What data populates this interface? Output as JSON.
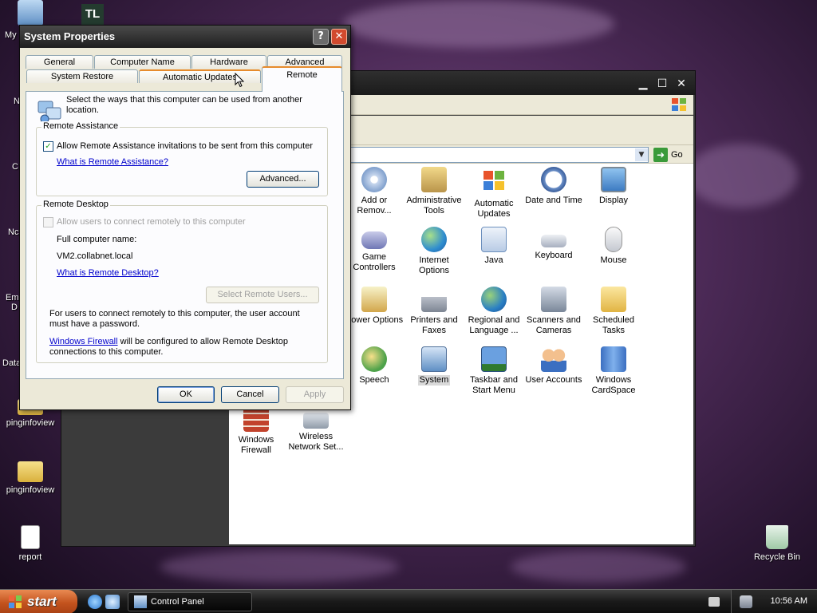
{
  "desktop": {
    "icons": [
      {
        "label": "pinginfoview"
      },
      {
        "label": "pinginfoview"
      },
      {
        "label": "report"
      },
      {
        "label": "Recycle Bin"
      }
    ],
    "partial_labels": [
      "My",
      "N",
      "C",
      "Nc",
      "Em",
      "D",
      "Data"
    ],
    "top_icon_text": "TL"
  },
  "control_panel": {
    "go_label": "Go",
    "items": [
      {
        "label": "Add or Remov..."
      },
      {
        "label": "Administrative Tools"
      },
      {
        "label": "Automatic Updates"
      },
      {
        "label": "Date and Time"
      },
      {
        "label": "Display"
      },
      {
        "label": "Game Controllers"
      },
      {
        "label": "Internet Options"
      },
      {
        "label": "Java"
      },
      {
        "label": "Keyboard"
      },
      {
        "label": "Mouse"
      },
      {
        "label": "Power Options"
      },
      {
        "label": "Printers and Faxes"
      },
      {
        "label": "Regional and Language ..."
      },
      {
        "label": "Scanners and Cameras"
      },
      {
        "label": "Scheduled Tasks"
      },
      {
        "label": "Speech"
      },
      {
        "label": "System"
      },
      {
        "label": "Taskbar and Start Menu"
      },
      {
        "label": "User Accounts"
      },
      {
        "label": "Windows CardSpace"
      },
      {
        "label": "Windows Firewall"
      },
      {
        "label": "Wireless Network Set..."
      }
    ]
  },
  "dialog": {
    "title": "System Properties",
    "help_label": "?",
    "close_label": "✕",
    "tabs": {
      "general": "General",
      "computer_name": "Computer Name",
      "hardware": "Hardware",
      "advanced": "Advanced",
      "system_restore": "System Restore",
      "automatic_updates": "Automatic Updates",
      "remote": "Remote"
    },
    "intro": "Select the ways that this computer can be used from another location.",
    "remote_assistance": {
      "group_label": "Remote Assistance",
      "checkbox_label": "Allow Remote Assistance invitations to be sent from this computer",
      "checked": true,
      "link": "What is Remote Assistance?",
      "advanced_button": "Advanced..."
    },
    "remote_desktop": {
      "group_label": "Remote Desktop",
      "checkbox_label": "Allow users to connect remotely to this computer",
      "checked": false,
      "full_name_label": "Full computer name:",
      "full_name_value": "VM2.collabnet.local",
      "link": "What is Remote Desktop?",
      "select_users_button": "Select Remote Users...",
      "password_note": "For users to connect remotely to this computer, the user account must have a password.",
      "firewall_link": "Windows Firewall",
      "firewall_note": " will be configured to allow Remote Desktop connections to this computer."
    },
    "buttons": {
      "ok": "OK",
      "cancel": "Cancel",
      "apply": "Apply"
    }
  },
  "taskbar": {
    "start_label": "start",
    "task_label": "Control Panel",
    "clock": "10:56 AM"
  },
  "colors": {
    "xp_start_orange": "#c3531e",
    "tab_highlight": "#e68b2c",
    "link_blue": "#0000cc",
    "check_green": "#21a121"
  }
}
